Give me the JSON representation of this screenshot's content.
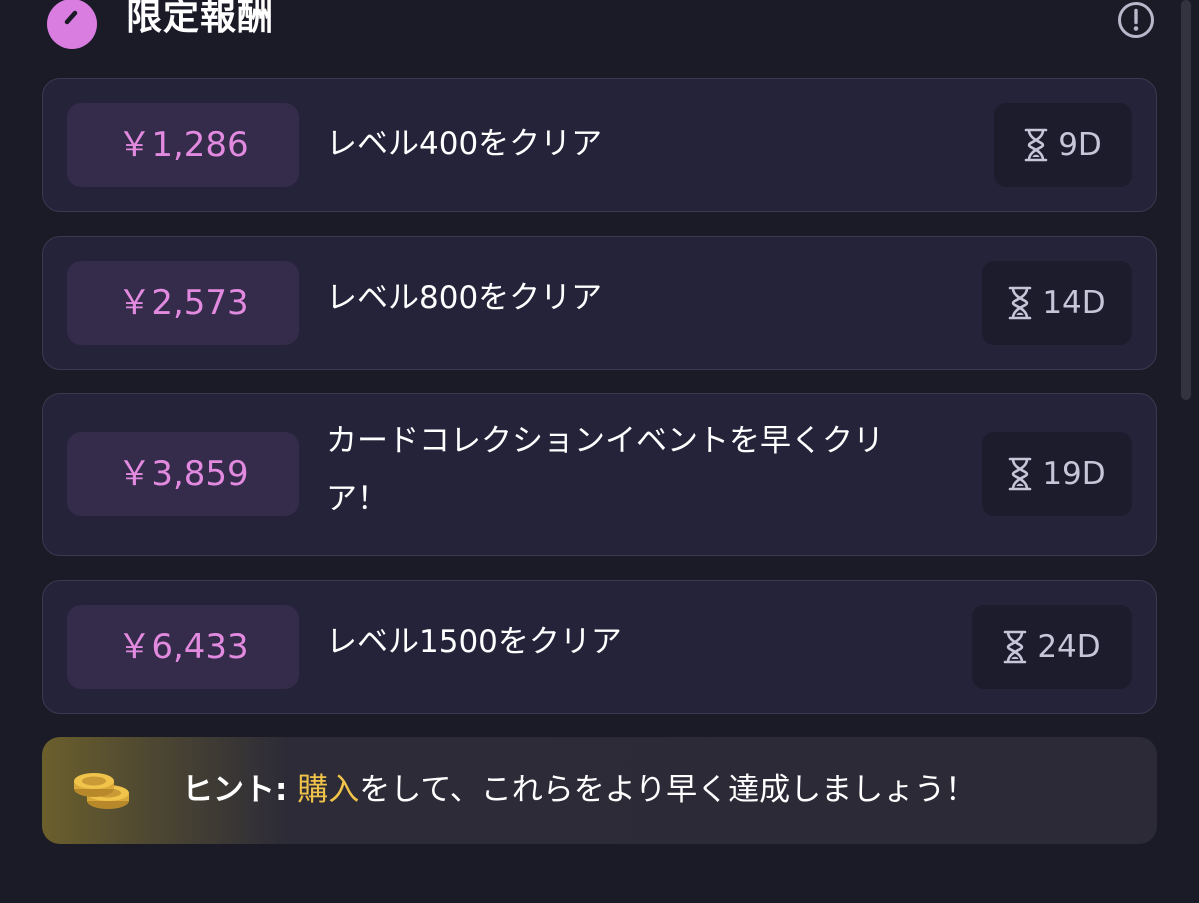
{
  "header": {
    "title": "限定報酬",
    "icon": "timer-icon",
    "info_icon": "info-icon"
  },
  "rewards": [
    {
      "price": "￥1,286",
      "task": "レベル400をクリア",
      "time": "9D"
    },
    {
      "price": "￥2,573",
      "task": "レベル800をクリア",
      "time": "14D"
    },
    {
      "price": "￥3,859",
      "task": "カードコレクションイベントを早くクリア！",
      "time": "19D"
    },
    {
      "price": "￥6,433",
      "task": "レベル1500をクリア",
      "time": "24D"
    }
  ],
  "hint": {
    "label": "ヒント:",
    "highlight": "購入",
    "rest": "をして、これらをより早く達成しましょう！",
    "icon": "coins-icon"
  },
  "colors": {
    "background": "#1b1b28",
    "card": "#24233a",
    "price": "#e28ae0",
    "accent_icon": "#d97de0",
    "hint_highlight": "#f0c34a"
  }
}
